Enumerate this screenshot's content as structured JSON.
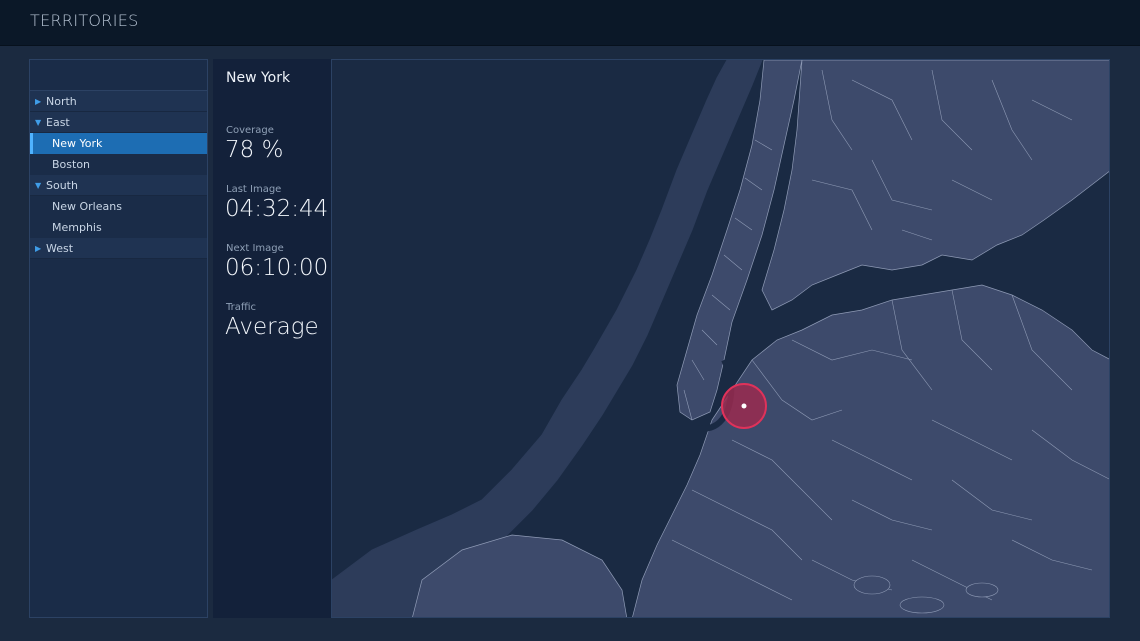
{
  "app": {
    "title": "TERRITORIES"
  },
  "sidebar": {
    "groups": [
      {
        "label": "North",
        "expanded": false,
        "items": []
      },
      {
        "label": "East",
        "expanded": true,
        "items": [
          {
            "label": "New York",
            "selected": true
          },
          {
            "label": "Boston",
            "selected": false
          }
        ]
      },
      {
        "label": "South",
        "expanded": true,
        "items": [
          {
            "label": "New Orleans",
            "selected": false
          },
          {
            "label": "Memphis",
            "selected": false
          }
        ]
      },
      {
        "label": "West",
        "expanded": false,
        "items": []
      }
    ]
  },
  "detail": {
    "city": "New York",
    "coverage_label": "Coverage",
    "coverage_value": "78 %",
    "last_image_label": "Last Image",
    "last_image_value": "04:32:44",
    "next_image_label": "Next Image",
    "next_image_value": "06:10:00",
    "traffic_label": "Traffic",
    "traffic_value": "Average"
  },
  "map": {
    "icon": "map-marker-icon",
    "colors": {
      "water": "#1a2a43",
      "land": "#3d4a6b",
      "borders": "#8f9bb6",
      "marker_fill": "#9a2a4f",
      "marker_stroke": "#e0325a"
    }
  }
}
